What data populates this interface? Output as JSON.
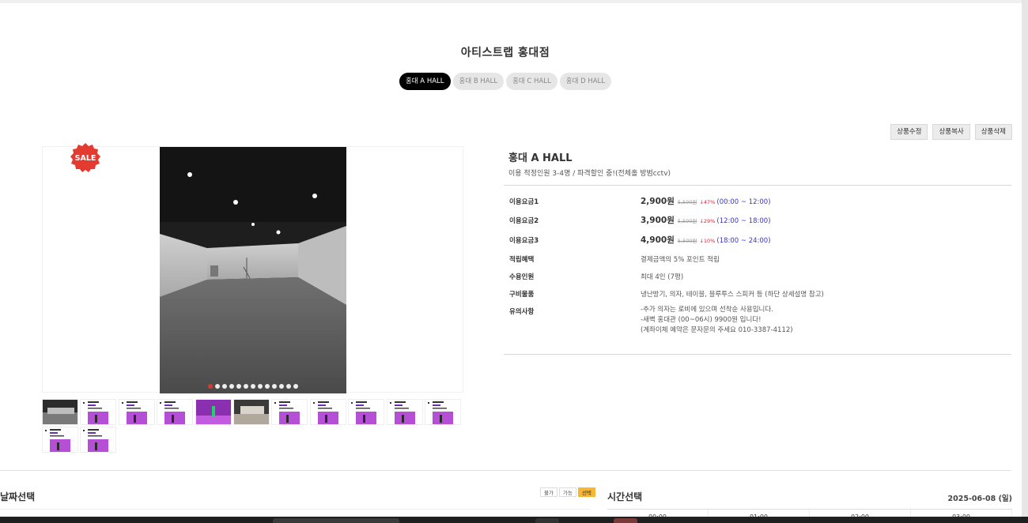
{
  "store_title": "아티스트랩 홍대점",
  "hall_tabs": [
    {
      "label": "홍대 A HALL",
      "active": true
    },
    {
      "label": "홍대 B HALL",
      "active": false
    },
    {
      "label": "홍대 C HALL",
      "active": false
    },
    {
      "label": "홍대 D HALL",
      "active": false
    }
  ],
  "admin_buttons": {
    "edit": "상품수정",
    "copy": "상품복사",
    "delete": "상품삭제"
  },
  "gallery": {
    "sale_badge": "SALE",
    "slide_count": 13,
    "active_slide": 1,
    "thumbnail_count": 13
  },
  "product": {
    "name": "홍대 A HALL",
    "subtitle": "이용 적정인원 3-4명 / 파격할인 중!(전체홀 방범cctv)",
    "rows": {
      "fee1": {
        "label": "이용요금1",
        "price": "2,900원",
        "original": "5,500원",
        "discount": "47%",
        "time": "(00:00 ~ 12:00)"
      },
      "fee2": {
        "label": "이용요금2",
        "price": "3,900원",
        "original": "5,500원",
        "discount": "29%",
        "time": "(12:00 ~ 18:00)"
      },
      "fee3": {
        "label": "이용요금3",
        "price": "4,900원",
        "original": "5,500원",
        "discount": "10%",
        "time": "(18:00 ~ 24:00)"
      },
      "points": {
        "label": "적립혜택",
        "value": "결제금액의 5% 포인트 적립"
      },
      "capacity": {
        "label": "수용인원",
        "value": "최대 4인 (7평)"
      },
      "amenities": {
        "label": "구비물품",
        "value": "냉난방기, 의자, 테이블, 블루투스 스피커 등 (하단 상세설명 참고)"
      },
      "notes": {
        "label": "유의사항",
        "line1": "-추가 의자는 로비에 있으며 선착순 사용입니다.",
        "line2": "-새벽 홍대관 (00~06시) 9900원 입니다!",
        "line3": "(계좌이체 예약은 문자문의 주세요 010-3387-4112)"
      }
    }
  },
  "date_section": {
    "title": "날짜선택",
    "legend": {
      "unavailable": "불가",
      "available": "가능",
      "selected": "선택"
    }
  },
  "time_section": {
    "title": "시간선택",
    "date": "2025-06-08 (일)",
    "slots": [
      "00:00",
      "01:00",
      "02:00",
      "03:00"
    ]
  },
  "colors": {
    "accent_red": "#e53a2f",
    "time_blue": "#3a36c8",
    "discount_red": "#e0223a",
    "selected_yellow": "#f7b733"
  }
}
